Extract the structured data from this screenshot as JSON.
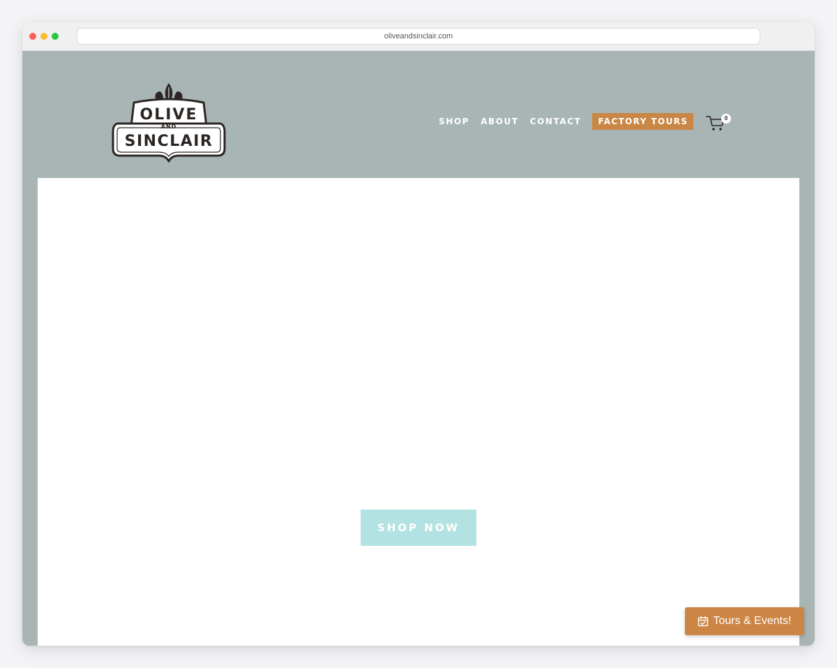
{
  "browser": {
    "url": "oliveandsinclair.com"
  },
  "logo": {
    "line1": "OLIVE",
    "line2": "AND",
    "line3": "SINCLAIR"
  },
  "nav": {
    "items": [
      {
        "label": "SHOP"
      },
      {
        "label": "ABOUT"
      },
      {
        "label": "CONTACT"
      }
    ],
    "highlight": {
      "label": "FACTORY TOURS"
    }
  },
  "cart": {
    "count": "0",
    "icon": "cart-icon"
  },
  "hero": {
    "button_label": "SHOP NOW"
  },
  "floating": {
    "tours_label": "Tours & Events!",
    "icon": "calendar-check-icon"
  },
  "colors": {
    "header_bg": "#a9b5b5",
    "accent": "#c98645",
    "shop_now_bg": "#b3e2e2"
  }
}
